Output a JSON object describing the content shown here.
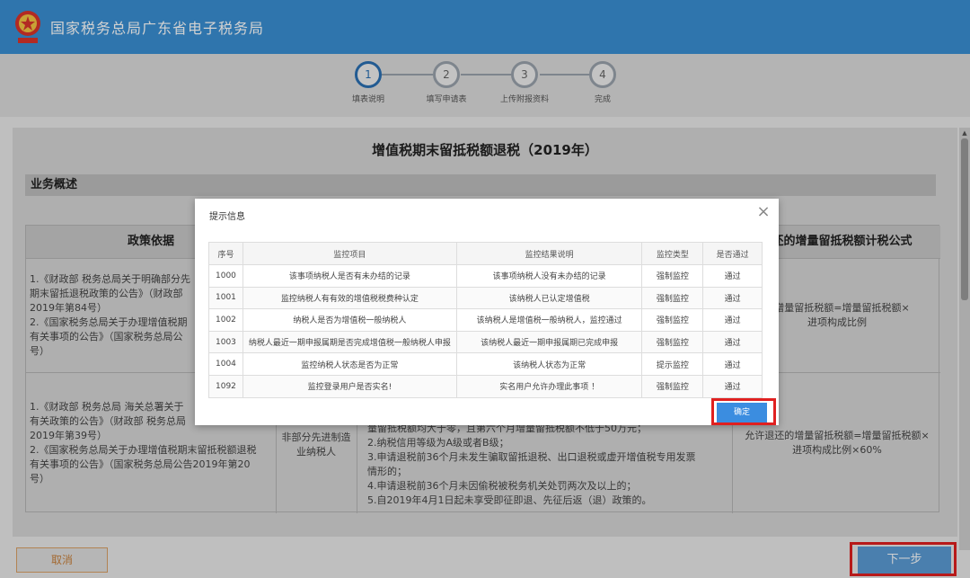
{
  "header": {
    "title": "国家税务总局广东省电子税务局"
  },
  "stepper": {
    "steps": [
      {
        "number": "1",
        "label": "填表说明"
      },
      {
        "number": "2",
        "label": "填写申请表"
      },
      {
        "number": "3",
        "label": "上传附报资料"
      },
      {
        "number": "4",
        "label": "完成"
      }
    ]
  },
  "page": {
    "title": "增值税期末留抵税额退税（2019年）",
    "section_title": "业务概述",
    "columns": {
      "policy": "政策依据",
      "formula": "退还的增量留抵税额计税公式"
    },
    "row1": {
      "policy": "1.《财政部 税务总局关于明确部分先\n期末留抵退税政策的公告》（财政部\n2019年第84号）\n2.《国家税务总局关于办理增值税期\n有关事项的公告》（国家税务总局公\n号）",
      "formula": "的增量留抵税额=增量留抵税额×\n进项构成比例"
    },
    "row2": {
      "policy": "1.《财政部 税务总局 海关总署关于\n有关政策的公告》（财政部 税务总局\n2019年第39号）\n2.《国家税务总局关于办理增值税期末留抵税额退税\n有关事项的公告》（国家税务总局公告2019年第20\n号）",
      "subject": "非部分先进制造\n业纳税人",
      "conditions": "量留抵税额均大于零，且第六个月增量留抵税额不低于50万元；\n2.纳税信用等级为A级或者B级；\n3.申请退税前36个月未发生骗取留抵退税、出口退税或虚开增值税专用发票\n情形的；\n4.申请退税前36个月未因偷税被税务机关处罚两次及以上的；\n5.自2019年4月1日起未享受即征即退、先征后返（退）政策的。",
      "formula": "允许退还的增量留抵税额=增量留抵税额×\n进项构成比例×60%"
    }
  },
  "footer": {
    "cancel_label": "取消",
    "next_label": "下一步"
  },
  "dialog": {
    "title": "提示信息",
    "confirm_label": "确定",
    "headers": [
      "序号",
      "监控项目",
      "监控结果说明",
      "监控类型",
      "是否通过"
    ],
    "rows": [
      [
        "1000",
        "该事项纳税人是否有未办结的记录",
        "该事项纳税人没有未办结的记录",
        "强制监控",
        "通过"
      ],
      [
        "1001",
        "监控纳税人有有效的增值税税费种认定",
        "该纳税人已认定增值税",
        "强制监控",
        "通过"
      ],
      [
        "1002",
        "纳税人是否为增值税一般纳税人",
        "该纳税人是增值税一般纳税人，监控通过",
        "强制监控",
        "通过"
      ],
      [
        "1003",
        "纳税人最近一期申报属期是否完成增值税一般纳税人申报",
        "该纳税人最近一期申报属期已完成申报",
        "强制监控",
        "通过"
      ],
      [
        "1004",
        "监控纳税人状态是否为正常",
        "该纳税人状态为正常",
        "提示监控",
        "通过"
      ],
      [
        "1092",
        "监控登录用户是否实名!",
        "实名用户允许办理此事项 ！",
        "强制监控",
        "通过"
      ]
    ]
  }
}
